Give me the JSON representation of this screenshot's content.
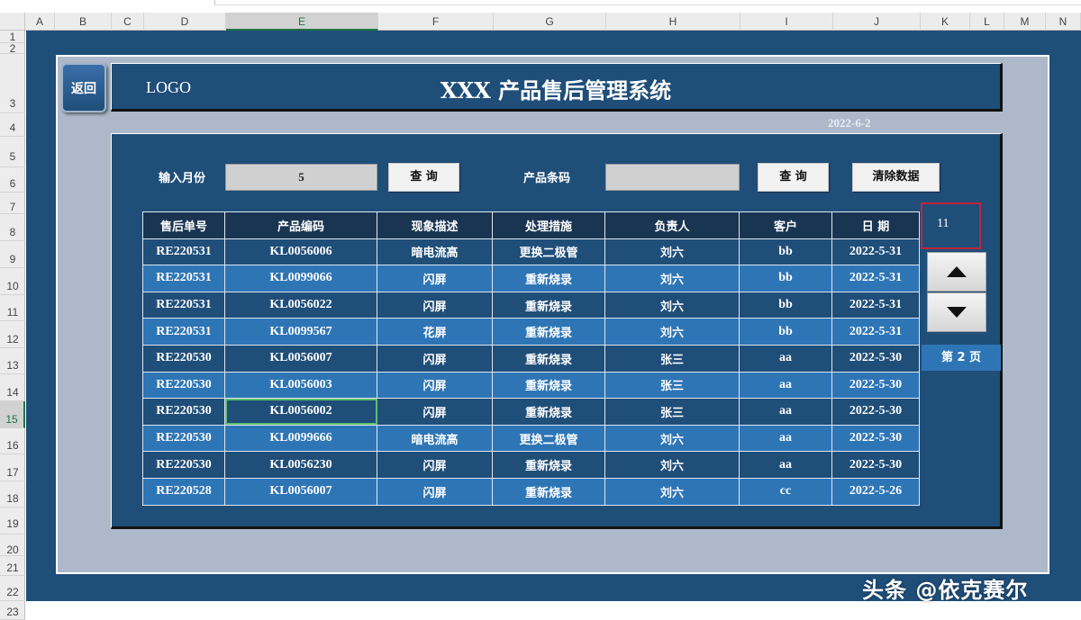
{
  "spreadsheet": {
    "columns": [
      "A",
      "B",
      "C",
      "D",
      "E",
      "F",
      "G",
      "H",
      "I",
      "J",
      "K",
      "L",
      "M",
      "N"
    ],
    "rows": [
      "1",
      "2",
      "3",
      "4",
      "5",
      "6",
      "7",
      "8",
      "9",
      "10",
      "11",
      "12",
      "13",
      "14",
      "15",
      "16",
      "17",
      "18",
      "19",
      "20",
      "21",
      "22",
      "23"
    ]
  },
  "header": {
    "back_label": "返回",
    "logo": "LOGO",
    "title": "XXX 产品售后管理系统",
    "date": "2022-6-2"
  },
  "filters": {
    "month_label": "输入月份",
    "month_value": "5",
    "query_label": "查 询",
    "barcode_label": "产品条码",
    "barcode_value": "",
    "query2_label": "查 询",
    "clear_label": "清除数据"
  },
  "table": {
    "headers": [
      "售后单号",
      "产品编码",
      "现象描述",
      "处理措施",
      "负责人",
      "客户",
      "日 期"
    ],
    "rows": [
      [
        "RE220531",
        "KL0056006",
        "暗电流高",
        "更换二极管",
        "刘六",
        "bb",
        "2022-5-31"
      ],
      [
        "RE220531",
        "KL0099066",
        "闪屏",
        "重新烧录",
        "刘六",
        "bb",
        "2022-5-31"
      ],
      [
        "RE220531",
        "KL0056022",
        "闪屏",
        "重新烧录",
        "刘六",
        "bb",
        "2022-5-31"
      ],
      [
        "RE220531",
        "KL0099567",
        "花屏",
        "重新烧录",
        "刘六",
        "bb",
        "2022-5-31"
      ],
      [
        "RE220530",
        "KL0056007",
        "闪屏",
        "重新烧录",
        "张三",
        "aa",
        "2022-5-30"
      ],
      [
        "RE220530",
        "KL0056003",
        "闪屏",
        "重新烧录",
        "张三",
        "aa",
        "2022-5-30"
      ],
      [
        "RE220530",
        "KL0056002",
        "闪屏",
        "重新烧录",
        "张三",
        "aa",
        "2022-5-30"
      ],
      [
        "RE220530",
        "KL0099666",
        "暗电流高",
        "更换二极管",
        "刘六",
        "aa",
        "2022-5-30"
      ],
      [
        "RE220530",
        "KL0056230",
        "闪屏",
        "重新烧录",
        "刘六",
        "aa",
        "2022-5-30"
      ],
      [
        "RE220528",
        "KL0056007",
        "闪屏",
        "重新烧录",
        "刘六",
        "cc",
        "2022-5-26"
      ]
    ]
  },
  "pager": {
    "count": "11",
    "up_icon": "triangle-up-icon",
    "down_icon": "triangle-down-icon",
    "page_label": "第 2 页"
  },
  "watermark": "头条 @依克赛尔",
  "colors": {
    "dashboard_bg": "#1f4e79",
    "frame_bg": "#adb9ca",
    "row_light": "#2e75b6",
    "row_dark": "#1f4e79",
    "count_border": "#c0243d"
  }
}
